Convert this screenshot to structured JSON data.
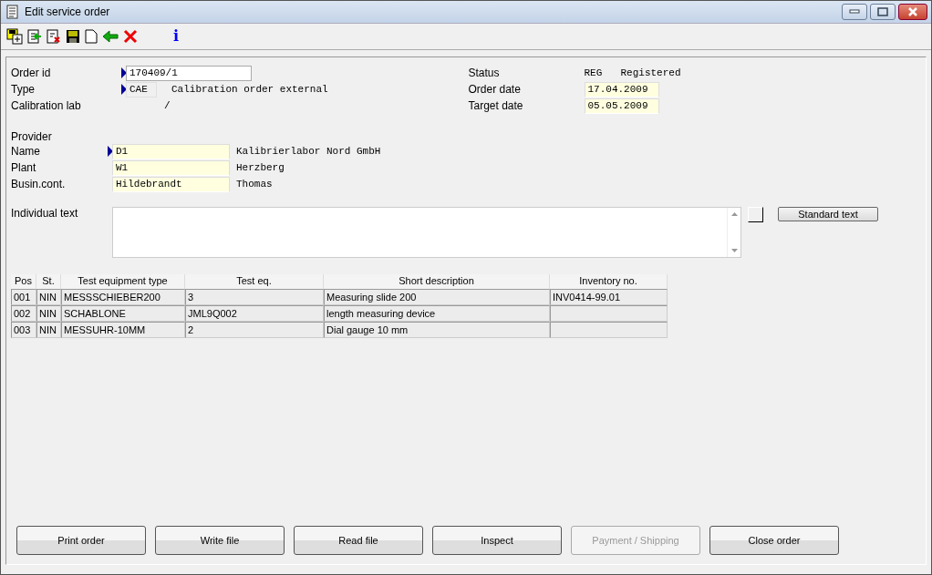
{
  "window": {
    "title": "Edit service order"
  },
  "toolbar": {
    "info": "i"
  },
  "header_left": [
    {
      "label": "Order id",
      "kind": "input",
      "required": true,
      "code": "170409/1"
    },
    {
      "label": "Type",
      "kind": "code",
      "required": true,
      "code": "CAE",
      "text": "Calibration order external"
    },
    {
      "label": "Calibration lab",
      "kind": "plain",
      "required": false,
      "code": "/"
    }
  ],
  "header_right": [
    {
      "label": "Status",
      "kind": "plain",
      "code": "REG",
      "text": "Registered"
    },
    {
      "label": "Order date",
      "kind": "date",
      "code": "17.04.2009"
    },
    {
      "label": "Target date",
      "kind": "date",
      "code": "05.05.2009"
    }
  ],
  "provider": {
    "title": "Provider",
    "fields": [
      {
        "label": "Name",
        "required": true,
        "value": "D1",
        "text": "Kalibrierlabor Nord GmbH"
      },
      {
        "label": "Plant",
        "required": false,
        "value": "W1",
        "text": "Herzberg"
      },
      {
        "label": "Busin.cont.",
        "required": false,
        "value": "Hildebrandt",
        "text": "Thomas"
      }
    ]
  },
  "individual_text": {
    "label": "Individual text",
    "button": "Standard text"
  },
  "table": {
    "columns": [
      "Pos",
      "St.",
      "Test equipment type",
      "Test eq.",
      "Short description",
      "Inventory no."
    ],
    "rows": [
      [
        "001",
        "NIN",
        "MESSSCHIEBER200",
        "3",
        "Measuring slide 200",
        "INV0414-99.01"
      ],
      [
        "002",
        "NIN",
        "SCHABLONE",
        "JML9Q002",
        "length measuring device",
        ""
      ],
      [
        "003",
        "NIN",
        "MESSUHR-10MM",
        "2",
        "Dial gauge 10 mm",
        ""
      ]
    ]
  },
  "buttons": [
    {
      "label": "Print order",
      "disabled": false
    },
    {
      "label": "Write file",
      "disabled": false
    },
    {
      "label": "Read file",
      "disabled": false
    },
    {
      "label": "Inspect",
      "disabled": false
    },
    {
      "label": "Payment / Shipping",
      "disabled": true
    },
    {
      "label": "Close order",
      "disabled": false
    }
  ]
}
